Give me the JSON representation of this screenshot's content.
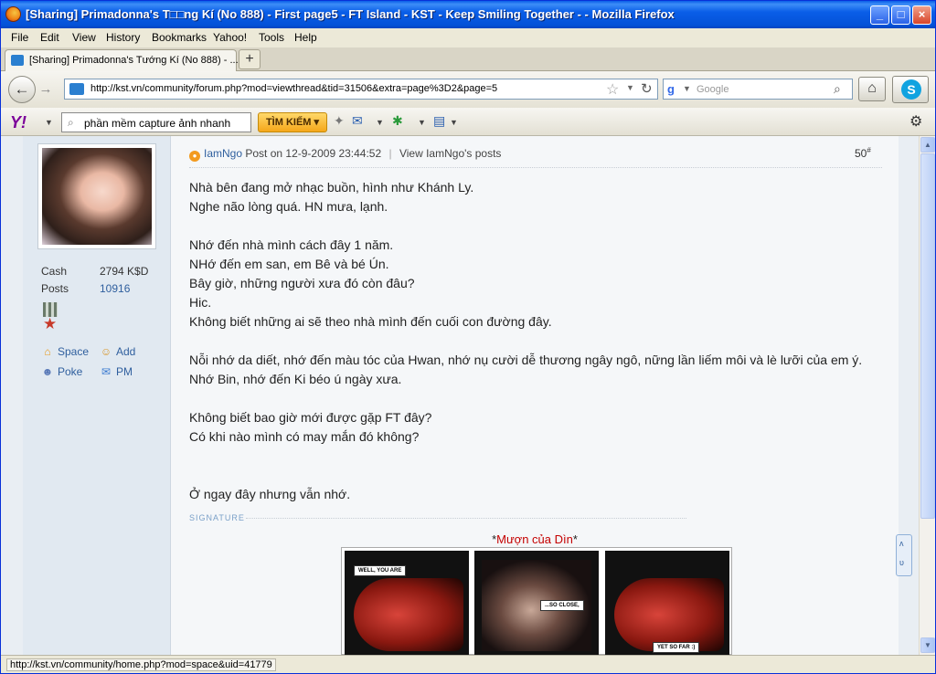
{
  "window": {
    "title": "[Sharing] Primadonna's T□□ng Kí (No 888) - First page5 - FT Island - KST - Keep Smiling Together - - Mozilla Firefox"
  },
  "menu": [
    "File",
    "Edit",
    "View",
    "History",
    "Bookmarks",
    "Yahoo!",
    "Tools",
    "Help"
  ],
  "tab": {
    "label": "[Sharing] Primadonna's Tướng Kí (No 888) - ...",
    "new_tab": "+"
  },
  "nav": {
    "url": "http://kst.vn/community/forum.php?mod=viewthread&tid=31506&extra=page%3D2&page=5",
    "search_placeholder": "Google"
  },
  "yahoo": {
    "search_value": "phần mềm capture ảnh nhanh",
    "button": "TÌM KIẾM ▾"
  },
  "profile": {
    "cash_label": "Cash",
    "cash_value": "2794 K$D",
    "posts_label": "Posts",
    "posts_value": "10916",
    "actions": {
      "space": "Space",
      "add": "Add",
      "poke": "Poke",
      "pm": "PM"
    }
  },
  "post": {
    "author": "IamNgo",
    "posted": "Post on 12-9-2009 23:44:52",
    "view_posts": "View IamNgo's posts",
    "floor": "50",
    "floor_sup": "#",
    "lines": [
      "Nhà bên đang mở nhạc buồn, hình như Khánh Ly.",
      "Nghe não lòng quá. HN mưa, lạnh.",
      "",
      "Nhớ đến nhà mình cách đây 1 năm.",
      "NHớ đến em san, em Bê và bé Ún.",
      "Bây giờ, những người xưa đó còn đâu?",
      "Hic.",
      "Không biết những ai sẽ theo nhà mình đến cuối con đường đây.",
      "",
      "Nỗi nhớ da diết, nhớ đến màu tóc của Hwan, nhớ nụ cười dễ thương ngây ngô, nững lần liếm môi và lè lưỡi của em ý.",
      "Nhớ Bin, nhớ đến Ki béo ú ngày xưa.",
      "",
      "Không biết bao giờ mới được gặp FT đây?",
      "Có khi nào mình có may mắn đó không?",
      "",
      "",
      "Ở ngay đây nhưng vẫn nhớ."
    ],
    "signature_label": "SIGNATURE",
    "sig_caption_prefix": "*",
    "sig_caption_red": "Mượn của Dìn",
    "sig_caption_suffix": "*",
    "comic_bubbles": [
      "WELL, YOU ARE",
      "...SO CLOSE,",
      "YET SO FAR :)"
    ]
  },
  "float_button": {
    "top": "ᴧ",
    "bottom": "ᴜ"
  },
  "status": {
    "text": "http://kst.vn/community/home.php?mod=space&uid=41779"
  },
  "icons": {
    "back": "back-arrow-icon",
    "forward": "forward-arrow-icon",
    "home": "home-icon",
    "reload": "reload-icon",
    "bookmark": "star-icon",
    "search": "magnifier-icon",
    "gear": "gear-icon"
  },
  "colors": {
    "titlebar": "#0a5ee8",
    "link": "#2f5f9e",
    "sig_red": "#c40000",
    "sidebar": "#e1e9f1",
    "post_bg": "#f5f7f9"
  }
}
